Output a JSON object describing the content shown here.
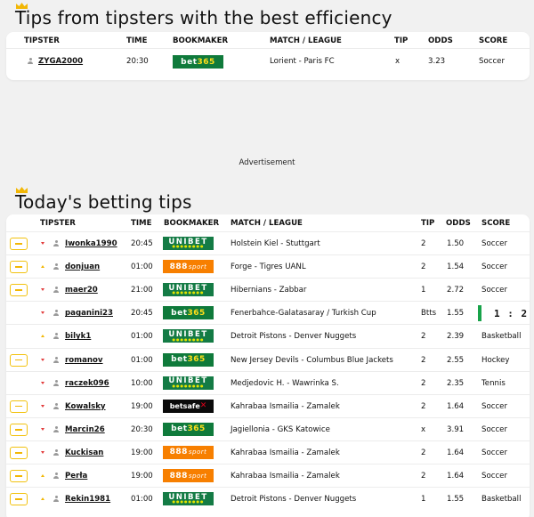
{
  "best": {
    "title": "Tips from tipsters with the best efficiency",
    "headers": {
      "tipster": "TIPSTER",
      "time": "TIME",
      "bookmaker": "BOOKMAKER",
      "match": "MATCH / LEAGUE",
      "tip": "TIP",
      "odds": "ODDS",
      "score": "SCORE"
    },
    "rows": [
      {
        "tipster": "ZYGA2000",
        "time": "20:30",
        "bookmaker": "bet365",
        "match": "Lorient - Paris FC",
        "tip": "x",
        "odds": "3.23",
        "score": "Soccer"
      }
    ]
  },
  "advertisement": "Advertisement",
  "today": {
    "title": "Today's betting tips",
    "headers": {
      "tipster": "TIPSTER",
      "time": "TIME",
      "bookmaker": "BOOKMAKER",
      "match": "MATCH / LEAGUE",
      "tip": "TIP",
      "odds": "ODDS",
      "score": "SCORE"
    },
    "rows": [
      {
        "coupon": true,
        "trend": "down",
        "tipster": "Iwonka1990",
        "time": "20:45",
        "bookmaker": "unibet",
        "match": "Holstein Kiel - Stuttgart",
        "tip": "2",
        "odds": "1.50",
        "score": "Soccer"
      },
      {
        "coupon": true,
        "trend": "up",
        "tipster": "donjuan",
        "time": "01:00",
        "bookmaker": "888sport",
        "match": "Forge - Tigres UANL",
        "tip": "2",
        "odds": "1.54",
        "score": "Soccer"
      },
      {
        "coupon": true,
        "trend": "down",
        "tipster": "maer20",
        "time": "21:00",
        "bookmaker": "unibet",
        "match": "Hibernians - Zabbar",
        "tip": "1",
        "odds": "2.72",
        "score": "Soccer"
      },
      {
        "coupon": false,
        "trend": "down",
        "tipster": "paganini23",
        "time": "20:45",
        "bookmaker": "bet365",
        "match": "Fenerbahce-Galatasaray / Turkish Cup",
        "tip": "Btts",
        "odds": "1.55",
        "score": "1 : 2",
        "live": true
      },
      {
        "coupon": false,
        "trend": "up",
        "tipster": "bilyk1",
        "time": "01:00",
        "bookmaker": "unibet",
        "match": "Detroit Pistons - Denver Nuggets",
        "tip": "2",
        "odds": "2.39",
        "score": "Basketball"
      },
      {
        "coupon": true,
        "trend": "down",
        "tipster": "romanov",
        "time": "01:00",
        "bookmaker": "bet365",
        "match": "New Jersey Devils - Columbus Blue Jackets",
        "tip": "2",
        "odds": "2.55",
        "score": "Hockey"
      },
      {
        "coupon": false,
        "trend": "down",
        "tipster": "raczek096",
        "time": "10:00",
        "bookmaker": "unibet",
        "match": "Medjedovic H. - Wawrinka S.",
        "tip": "2",
        "odds": "2.35",
        "score": "Tennis"
      },
      {
        "coupon": true,
        "trend": "down",
        "tipster": "Kowalsky",
        "time": "19:00",
        "bookmaker": "betsafe",
        "match": "Kahrabaa Ismailia - Zamalek",
        "tip": "2",
        "odds": "1.64",
        "score": "Soccer"
      },
      {
        "coupon": true,
        "trend": "down",
        "tipster": "Marcin26",
        "time": "20:30",
        "bookmaker": "bet365",
        "match": "Jagiellonia - GKS Katowice",
        "tip": "x",
        "odds": "3.91",
        "score": "Soccer"
      },
      {
        "coupon": true,
        "trend": "down",
        "tipster": "Kuckisan",
        "time": "19:00",
        "bookmaker": "888sport",
        "match": "Kahrabaa Ismailia - Zamalek",
        "tip": "2",
        "odds": "1.64",
        "score": "Soccer"
      },
      {
        "coupon": true,
        "trend": "up",
        "tipster": "Perła",
        "time": "19:00",
        "bookmaker": "888sport",
        "match": "Kahrabaa Ismailia - Zamalek",
        "tip": "2",
        "odds": "1.64",
        "score": "Soccer"
      },
      {
        "coupon": true,
        "trend": "up",
        "tipster": "Rekin1981",
        "time": "01:00",
        "bookmaker": "unibet",
        "match": "Detroit Pistons - Denver Nuggets",
        "tip": "1",
        "odds": "1.55",
        "score": "Basketball"
      }
    ]
  },
  "colors": {
    "accent": "#f2b705",
    "bet365": "#0f7a3b",
    "unibet": "#147b45",
    "888sport": "#f77f00",
    "betsafe": "#0a0a0a",
    "live": "#18a34a",
    "trend_down": "#e23b3b",
    "trend_up": "#f2b705"
  }
}
